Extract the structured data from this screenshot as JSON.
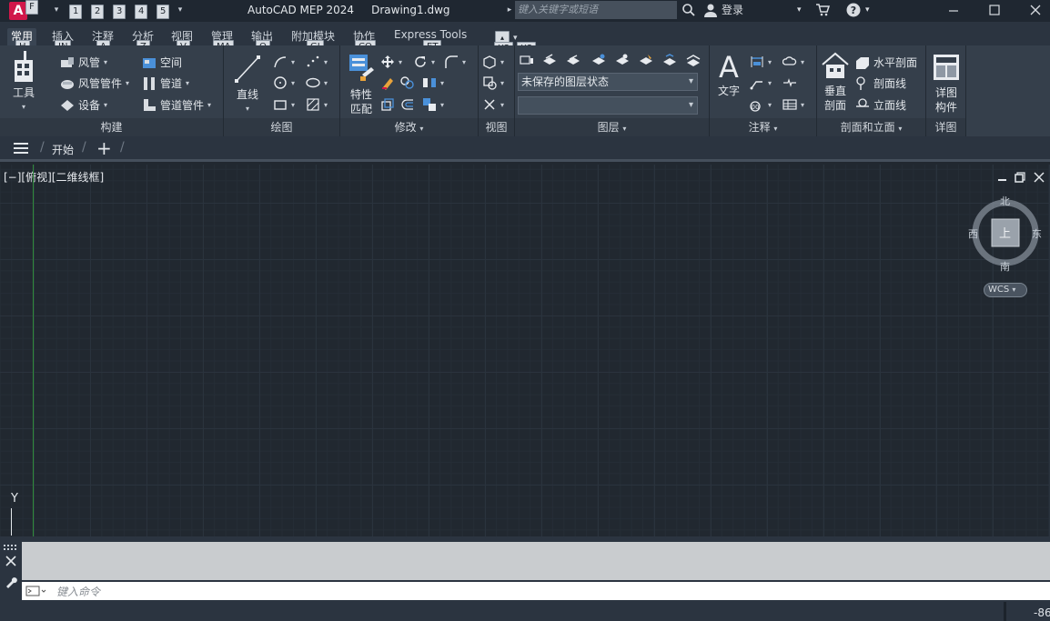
{
  "app": {
    "logo_letter": "A",
    "title": "AutoCAD MEP 2024",
    "document": "Drawing1.dwg"
  },
  "keytips": {
    "app_menu": "F",
    "qat": [
      "1",
      "2",
      "3",
      "4",
      "5"
    ],
    "tabs": [
      "H",
      "IN",
      "A",
      "Z",
      "V",
      "MA",
      "O",
      "GI",
      "CO",
      "ET",
      "X2",
      "X3"
    ]
  },
  "search": {
    "placeholder": "键入关键字或短语"
  },
  "user": {
    "login": "登录"
  },
  "ribbon_tabs": [
    "常用",
    "插入",
    "注释",
    "分析",
    "视图",
    "管理",
    "输出",
    "附加模块",
    "协作",
    "Express Tools"
  ],
  "panels": {
    "build": {
      "label": "构建",
      "tools_big": "工具",
      "items": [
        "风管",
        "风管管件",
        "设备",
        "空间",
        "管道",
        "管道管件"
      ]
    },
    "draw": {
      "label": "绘图",
      "line": "直线"
    },
    "modify": {
      "label": "修改",
      "match": [
        "特性",
        "匹配"
      ]
    },
    "view": {
      "label": "视图"
    },
    "layers": {
      "label": "图层",
      "layer_state": "未保存的图层状态",
      "layer_current": ""
    },
    "annotation": {
      "label": "注释",
      "text": "文字"
    },
    "section": {
      "label": "剖面和立面",
      "vertical": [
        "垂直",
        "剖面"
      ],
      "items": [
        "水平剖面",
        "剖面线",
        "立面线"
      ]
    },
    "detail": {
      "label": "详图",
      "detail_component": [
        "详图",
        "构件"
      ]
    }
  },
  "file_tabs": {
    "start": "开始",
    "add": "+"
  },
  "viewport": {
    "label": "[−][俯视][二维线框]",
    "viewcube": {
      "north": "北",
      "south": "南",
      "east": "东",
      "west": "西",
      "face": "上",
      "wcs": "WCS"
    },
    "ucs_y": "Y"
  },
  "command": {
    "history": "",
    "placeholder": "键入命令"
  },
  "status": {
    "coord": "-86"
  },
  "colors": {
    "accent": "#d1174a",
    "ribbon": "#353f4b",
    "canvas": "#212830",
    "ucs_green": "#2f8a3a"
  }
}
